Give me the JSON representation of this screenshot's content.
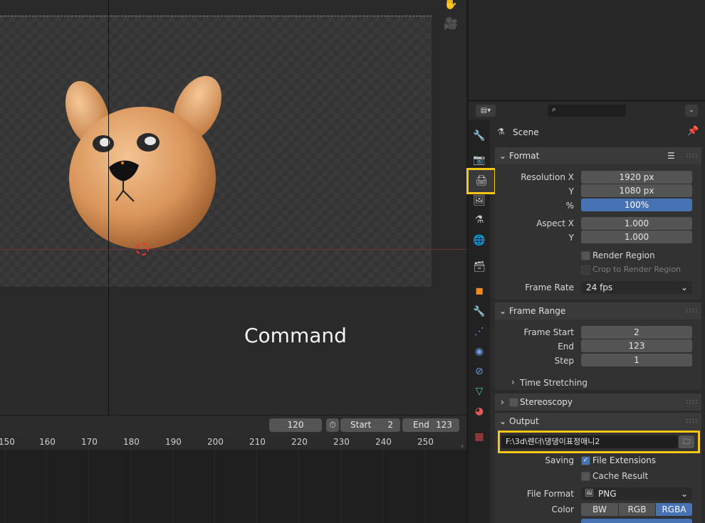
{
  "viewport": {
    "overlay_text": "Command"
  },
  "timeline": {
    "current_frame": "120",
    "start_label": "Start",
    "start_value": "2",
    "end_label": "End",
    "end_value": "123",
    "ticks": [
      "150",
      "160",
      "170",
      "180",
      "190",
      "200",
      "210",
      "220",
      "230",
      "240",
      "250"
    ]
  },
  "properties": {
    "search_placeholder": "",
    "context_title": "Scene",
    "format": {
      "title": "Format",
      "resolution_x_label": "Resolution X",
      "resolution_x": "1920 px",
      "resolution_y_label": "Y",
      "resolution_y": "1080 px",
      "percent_label": "%",
      "percent": "100%",
      "aspect_x_label": "Aspect X",
      "aspect_x": "1.000",
      "aspect_y_label": "Y",
      "aspect_y": "1.000",
      "render_region": "Render Region",
      "crop_region": "Crop to Render Region",
      "frame_rate_label": "Frame Rate",
      "frame_rate": "24 fps"
    },
    "frame_range": {
      "title": "Frame Range",
      "start_label": "Frame Start",
      "start": "2",
      "end_label": "End",
      "end": "123",
      "step_label": "Step",
      "step": "1",
      "time_stretching": "Time Stretching"
    },
    "stereoscopy": "Stereoscopy",
    "output": {
      "title": "Output",
      "path": "F:\\3d\\렌더\\댕댕이표정애니2",
      "saving_label": "Saving",
      "file_extensions": "File Extensions",
      "cache_result": "Cache Result",
      "file_format_label": "File Format",
      "file_format": "PNG",
      "color_label": "Color",
      "color_options": [
        "BW",
        "RGB",
        "RGBA"
      ],
      "color_selected": "RGBA"
    }
  },
  "colors": {
    "accent": "#4772b3",
    "highlight": "#f5c518"
  }
}
